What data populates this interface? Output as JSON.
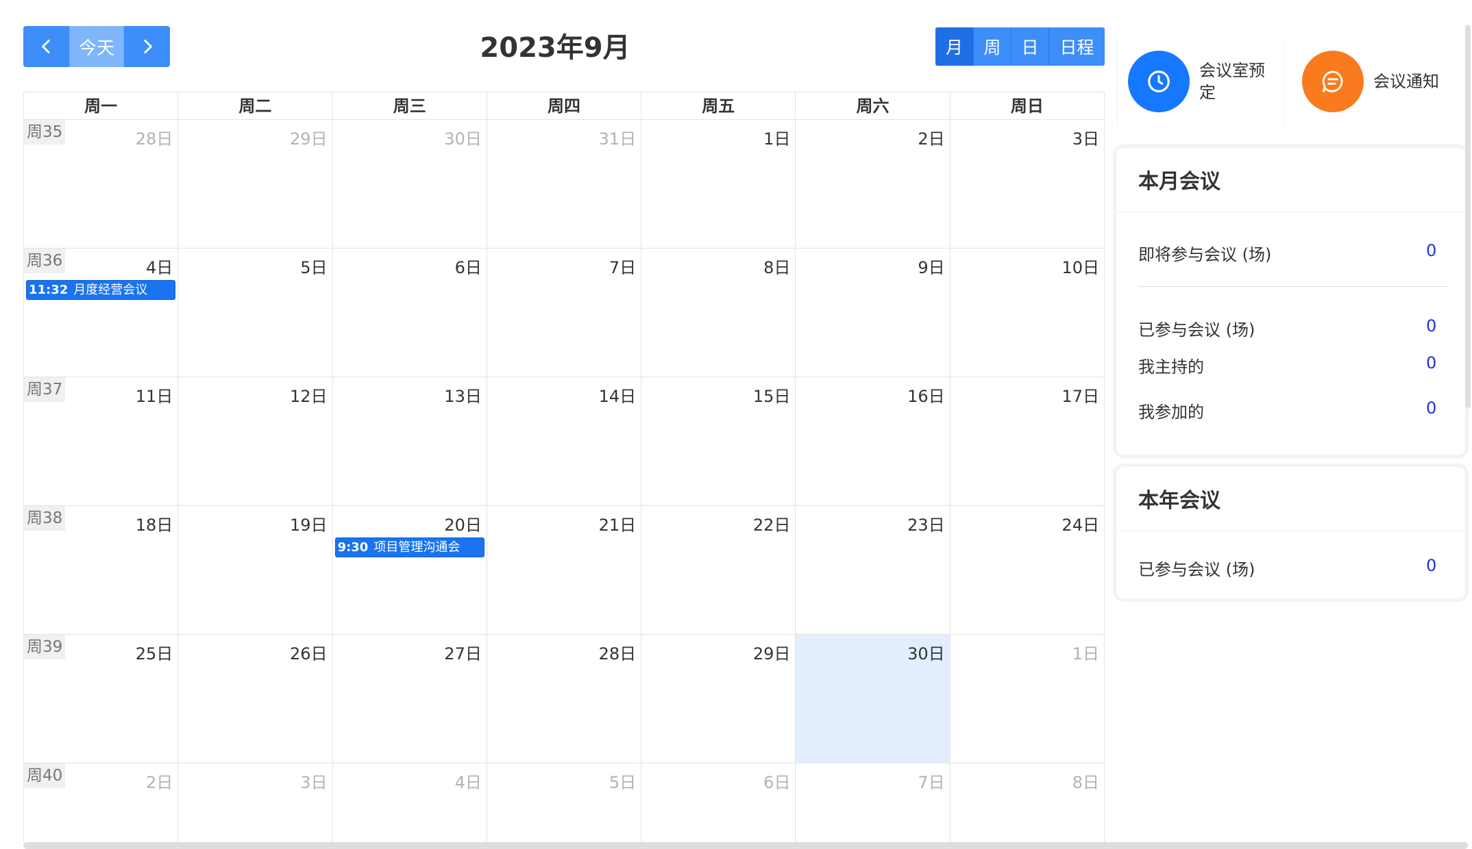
{
  "toolbar": {
    "prev_icon": "chevron-left-icon",
    "today_label": "今天",
    "next_icon": "chevron-right-icon",
    "title": "2023年9月",
    "views": [
      {
        "label": "月",
        "active": true
      },
      {
        "label": "周",
        "active": false
      },
      {
        "label": "日",
        "active": false
      },
      {
        "label": "日程",
        "active": false
      }
    ]
  },
  "calendar": {
    "weekday_headers": [
      "周一",
      "周二",
      "周三",
      "周四",
      "周五",
      "周六",
      "周日"
    ],
    "weeks": [
      {
        "week": "周35",
        "days": [
          {
            "label": "28日",
            "other": true
          },
          {
            "label": "29日",
            "other": true
          },
          {
            "label": "30日",
            "other": true
          },
          {
            "label": "31日",
            "other": true
          },
          {
            "label": "1日"
          },
          {
            "label": "2日"
          },
          {
            "label": "3日"
          }
        ]
      },
      {
        "week": "周36",
        "days": [
          {
            "label": "4日",
            "event": {
              "time": "11:32",
              "title": "月度经营会议"
            }
          },
          {
            "label": "5日"
          },
          {
            "label": "6日"
          },
          {
            "label": "7日"
          },
          {
            "label": "8日"
          },
          {
            "label": "9日"
          },
          {
            "label": "10日"
          }
        ]
      },
      {
        "week": "周37",
        "days": [
          {
            "label": "11日"
          },
          {
            "label": "12日"
          },
          {
            "label": "13日"
          },
          {
            "label": "14日"
          },
          {
            "label": "15日"
          },
          {
            "label": "16日"
          },
          {
            "label": "17日"
          }
        ]
      },
      {
        "week": "周38",
        "days": [
          {
            "label": "18日"
          },
          {
            "label": "19日"
          },
          {
            "label": "20日",
            "event": {
              "time": "9:30",
              "title": "项目管理沟通会"
            }
          },
          {
            "label": "21日"
          },
          {
            "label": "22日"
          },
          {
            "label": "23日"
          },
          {
            "label": "24日"
          }
        ]
      },
      {
        "week": "周39",
        "days": [
          {
            "label": "25日"
          },
          {
            "label": "26日"
          },
          {
            "label": "27日"
          },
          {
            "label": "28日"
          },
          {
            "label": "29日"
          },
          {
            "label": "30日",
            "today": true
          },
          {
            "label": "1日",
            "other": true
          }
        ]
      },
      {
        "week": "周40",
        "days": [
          {
            "label": "2日",
            "other": true
          },
          {
            "label": "3日",
            "other": true
          },
          {
            "label": "4日",
            "other": true
          },
          {
            "label": "5日",
            "other": true
          },
          {
            "label": "6日",
            "other": true
          },
          {
            "label": "7日",
            "other": true
          },
          {
            "label": "8日",
            "other": true
          }
        ]
      }
    ]
  },
  "quick_actions": [
    {
      "label": "会议室预定",
      "icon": "clock-icon",
      "color": "#1677ff"
    },
    {
      "label": "会议通知",
      "icon": "message-icon",
      "color": "#fa7a1e"
    }
  ],
  "month_panel": {
    "title": "本月会议",
    "upcoming_label": "即将参与会议 (场)",
    "upcoming_value": "0",
    "attended_label": "已参与会议 (场)",
    "attended_value": "0",
    "hosted_label": "我主持的",
    "hosted_value": "0",
    "joined_label": "我参加的",
    "joined_value": "0"
  },
  "year_panel": {
    "title": "本年会议",
    "attended_label": "已参与会议 (场)",
    "attended_value": "0"
  },
  "colors": {
    "primary": "#3d8ef8",
    "event": "#1a73f0",
    "today_bg": "#e2eefd",
    "stat_value": "#2431d8"
  }
}
